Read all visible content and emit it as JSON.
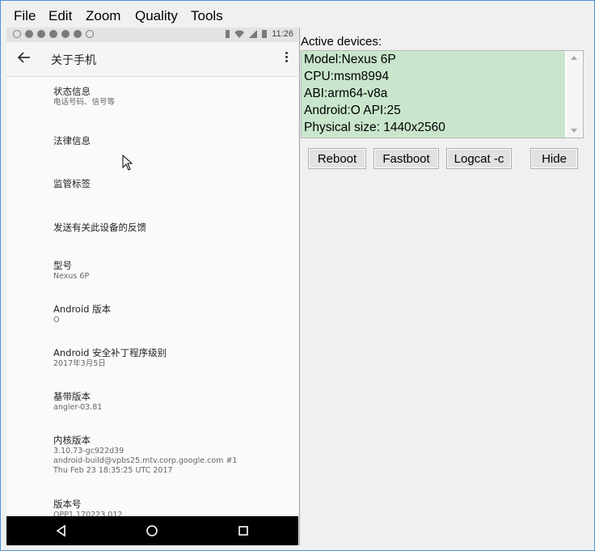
{
  "menu": {
    "file": "File",
    "edit": "Edit",
    "zoom": "Zoom",
    "quality": "Quality",
    "tools": "Tools"
  },
  "phone": {
    "status_time": "11:26",
    "toolbar_title": "关于手机",
    "items": [
      {
        "title": "状态信息",
        "subtitle": "电话号码、信号等"
      },
      {
        "title": "法律信息",
        "subtitle": ""
      },
      {
        "title": "监管标签",
        "subtitle": ""
      },
      {
        "title": "发送有关此设备的反馈",
        "subtitle": ""
      },
      {
        "title": "型号",
        "subtitle": "Nexus 6P"
      },
      {
        "title": "Android 版本",
        "subtitle": "O"
      },
      {
        "title": "Android 安全补丁程序级别",
        "subtitle": "2017年3月5日"
      },
      {
        "title": "基带版本",
        "subtitle": "angler-03.81"
      },
      {
        "title": "内核版本",
        "subtitle": "3.10.73-gc922d39",
        "subtitle2": "android-build@vpbs25.mtv.corp.google.com #1",
        "subtitle3": "Thu Feb 23 18:35:25 UTC 2017"
      },
      {
        "title": "版本号",
        "subtitle": "OPP1.170223.012"
      }
    ]
  },
  "devices": {
    "label": "Active devices:",
    "lines": [
      "Model:Nexus 6P",
      "CPU:msm8994",
      "ABI:arm64-v8a",
      "Android:O API:25",
      "Physical size: 1440x2560"
    ],
    "highlight_color": "#c9e6cc"
  },
  "buttons": {
    "reboot": "Reboot",
    "fastboot": "Fastboot",
    "logcat": "Logcat -c",
    "hide": "Hide"
  }
}
